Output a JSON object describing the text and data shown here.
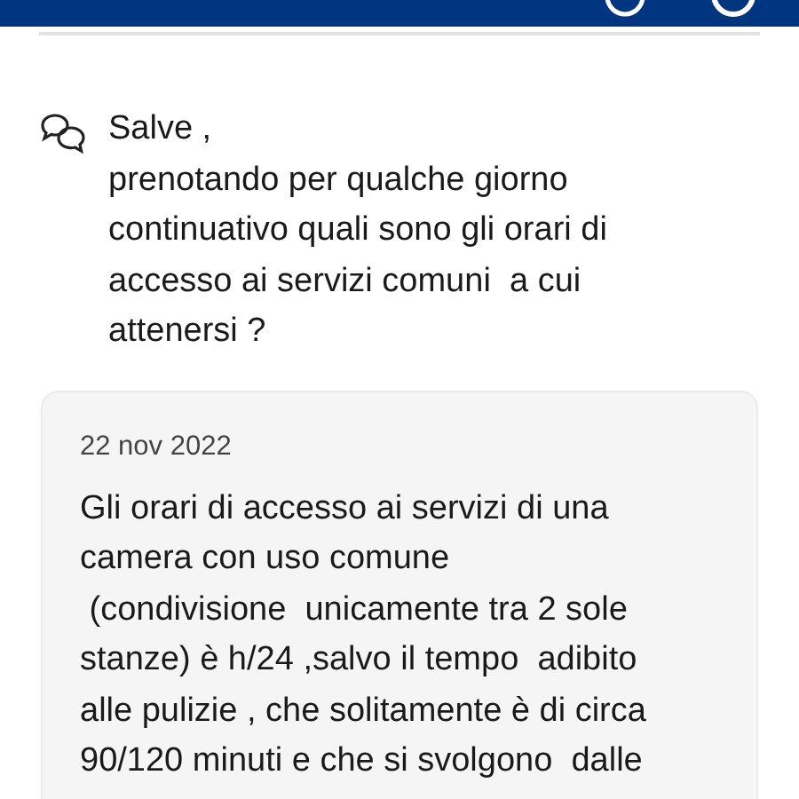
{
  "question": {
    "text": "Salve ,\nprenotando per qualche giorno\ncontinuativo quali sono gli orari di\naccesso ai servizi comuni  a cui\nattenersi ?"
  },
  "answer": {
    "date": "22 nov 2022",
    "text": "Gli orari di accesso ai servizi di una\ncamera con uso comune\n (condivisione  unicamente tra 2 sole\nstanze) è h/24 ,salvo il tempo  adibito\nalle pulizie , che solitamente è di circa\n90/120 minuti e che si svolgono  dalle"
  }
}
